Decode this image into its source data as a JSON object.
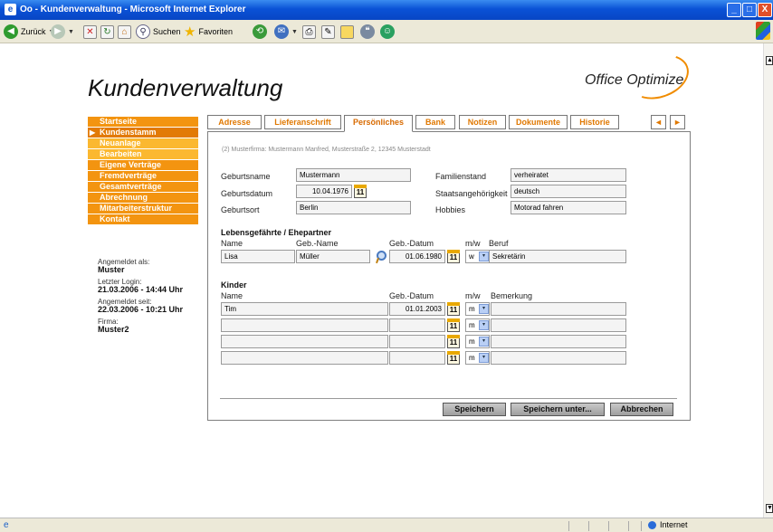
{
  "window": {
    "title": "Oo - Kundenverwaltung - Microsoft Internet Explorer",
    "minimize_glyph": "_",
    "maximize_glyph": "□",
    "close_glyph": "X"
  },
  "toolbar": {
    "back_label": "Zurück",
    "search_label": "Suchen",
    "favorites_label": "Favoriten",
    "icons": [
      "back-icon",
      "forward-icon",
      "stop-icon",
      "refresh-icon",
      "home-icon",
      "search-icon",
      "favorites-icon",
      "history-icon",
      "mail-icon",
      "print-icon",
      "edit-icon",
      "folder-icon",
      "discuss-icon",
      "messenger-icon"
    ]
  },
  "status": {
    "zone_label": "Internet"
  },
  "page": {
    "title": "Kundenverwaltung",
    "logo": "Office Optimize"
  },
  "menu": {
    "items": [
      {
        "label": "Startseite"
      },
      {
        "label": "Kundenstamm"
      },
      {
        "label": "Neuanlage"
      },
      {
        "label": "Bearbeiten"
      },
      {
        "label": "Eigene Verträge"
      },
      {
        "label": "Fremdverträge"
      },
      {
        "label": "Gesamtverträge"
      },
      {
        "label": "Abrechnung"
      },
      {
        "label": "Mitarbeiterstruktur"
      },
      {
        "label": "Kontakt"
      }
    ],
    "caret_glyph": "▶"
  },
  "user": {
    "logged_in_label": "Angemeldet als:",
    "logged_in_value": "Muster",
    "last_login_label": "Letzter Login:",
    "last_login_value": "21.03.2006 - 14:44 Uhr",
    "since_label": "Angemeldet seit:",
    "since_value": "22.03.2006 - 10:21 Uhr",
    "company_label": "Firma:",
    "company_value": "Muster2"
  },
  "tabs": {
    "items": [
      {
        "label": "Adresse"
      },
      {
        "label": "Lieferanschrift"
      },
      {
        "label": "Persönliches"
      },
      {
        "label": "Bank"
      },
      {
        "label": "Notizen"
      },
      {
        "label": "Dokumente"
      },
      {
        "label": "Historie"
      }
    ],
    "prev_glyph": "◄",
    "next_glyph": "►",
    "active": "Persönliches"
  },
  "breadcrumb": "(2) Musterfirma: Mustermann Manfred, Musterstraße 2, 12345 Musterstadt",
  "personal": {
    "birthname_label": "Geburtsname",
    "birthname_value": "Mustermann",
    "birthdate_label": "Geburtsdatum",
    "birthdate_value": "10.04.1976",
    "birthplace_label": "Geburtsort",
    "birthplace_value": "Berlin",
    "marital_label": "Familienstand",
    "marital_value": "verheiratet",
    "nationality_label": "Staatsangehörigkeit",
    "nationality_value": "deutsch",
    "hobbies_label": "Hobbies",
    "hobbies_value": "Motorad fahren"
  },
  "partner": {
    "section_title": "Lebensgefährte / Ehepartner",
    "col_name": "Name",
    "col_birthname": "Geb.-Name",
    "col_birthdate": "Geb.-Datum",
    "col_gender": "m/w",
    "col_job": "Beruf",
    "name": "Lisa",
    "birthname": "Müller",
    "birthdate": "01.06.1980",
    "gender": "w",
    "job": "Sekretärin"
  },
  "children": {
    "section_title": "Kinder",
    "col_name": "Name",
    "col_birthdate": "Geb.-Datum",
    "col_gender": "m/w",
    "col_note": "Bemerkung",
    "rows": [
      {
        "name": "Tim",
        "birthdate": "01.01.2003",
        "gender": "m",
        "note": ""
      },
      {
        "name": "",
        "birthdate": "",
        "gender": "m",
        "note": ""
      },
      {
        "name": "",
        "birthdate": "",
        "gender": "m",
        "note": ""
      },
      {
        "name": "",
        "birthdate": "",
        "gender": "m",
        "note": ""
      }
    ]
  },
  "calendar_glyph": "11",
  "dropdown_glyph": "▾",
  "buttons": {
    "save": "Speichern",
    "save_as": "Speichern unter...",
    "cancel": "Abbrechen"
  }
}
